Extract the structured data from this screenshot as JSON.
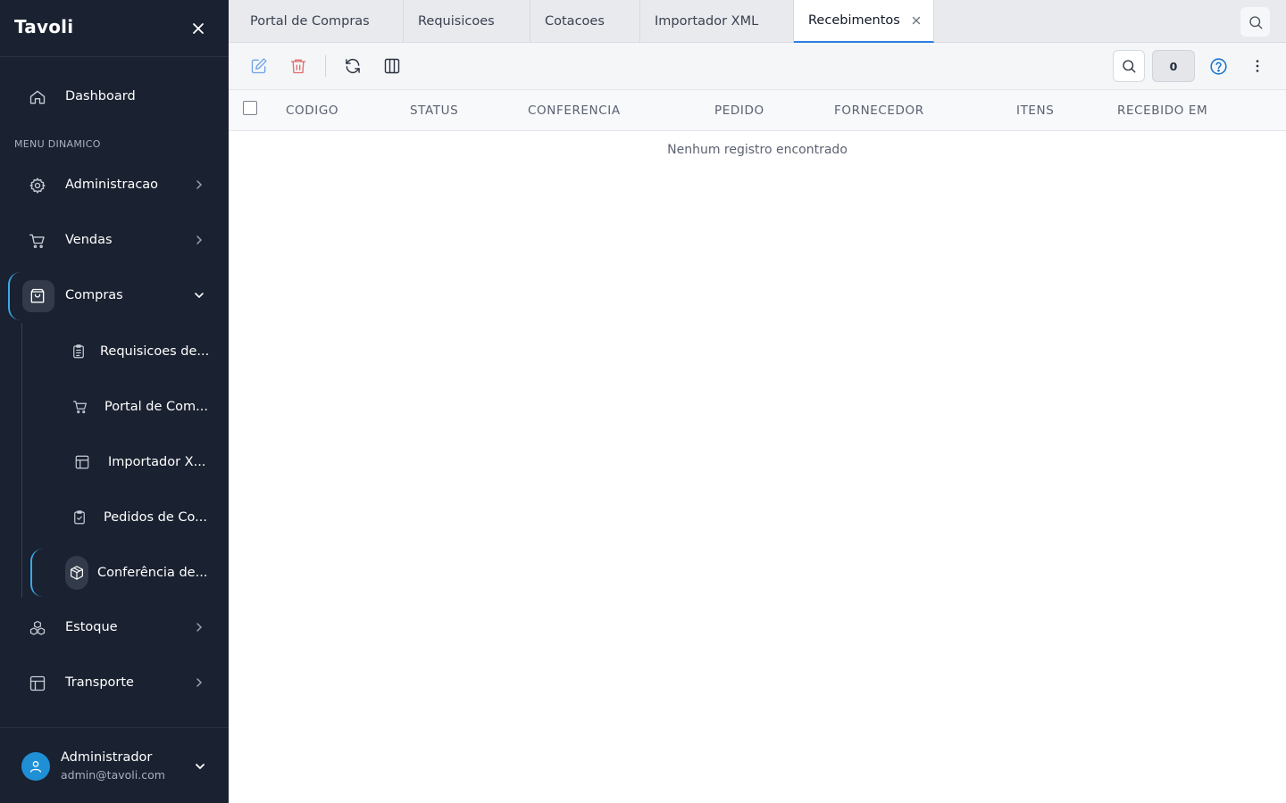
{
  "sidebar": {
    "brand": "Tavoli",
    "dashboard": "Dashboard",
    "section_label": "MENU DINAMICO",
    "items": [
      {
        "label": "Administracao",
        "icon": "gear-icon"
      },
      {
        "label": "Vendas",
        "icon": "cart-icon"
      },
      {
        "label": "Compras",
        "icon": "shopping-bag-icon",
        "expanded": true
      },
      {
        "label": "Estoque",
        "icon": "boxes-icon"
      },
      {
        "label": "Transporte",
        "icon": "layout-icon"
      }
    ],
    "sub_items": [
      {
        "label": "Requisicoes de...",
        "icon": "clipboard-list-icon"
      },
      {
        "label": "Portal de Com...",
        "icon": "cart-icon"
      },
      {
        "label": "Importador X...",
        "icon": "layout-icon"
      },
      {
        "label": "Pedidos de Co...",
        "icon": "clipboard-check-icon"
      },
      {
        "label": "Conferência de...",
        "icon": "package-icon",
        "active": true
      }
    ],
    "user": {
      "name": "Administrador",
      "email": "admin@tavoli.com"
    }
  },
  "tabs": [
    {
      "label": "Portal de Compras"
    },
    {
      "label": "Requisicoes"
    },
    {
      "label": "Cotacoes"
    },
    {
      "label": "Importador XML"
    },
    {
      "label": "Recebimentos",
      "active": true
    }
  ],
  "toolbar": {
    "count": "0"
  },
  "table": {
    "columns": [
      "CODIGO",
      "STATUS",
      "CONFERENCIA",
      "PEDIDO",
      "FORNECEDOR",
      "ITENS",
      "RECEBIDO EM"
    ],
    "empty_message": "Nenhum registro encontrado"
  },
  "colors": {
    "sidebar_bg": "#1a2130",
    "accent": "#3aa9e8",
    "tab_active_border": "#2f7fe0",
    "delete_icon": "#e06b6b",
    "edit_icon": "#6fa3e6",
    "help_icon": "#1877c9"
  }
}
